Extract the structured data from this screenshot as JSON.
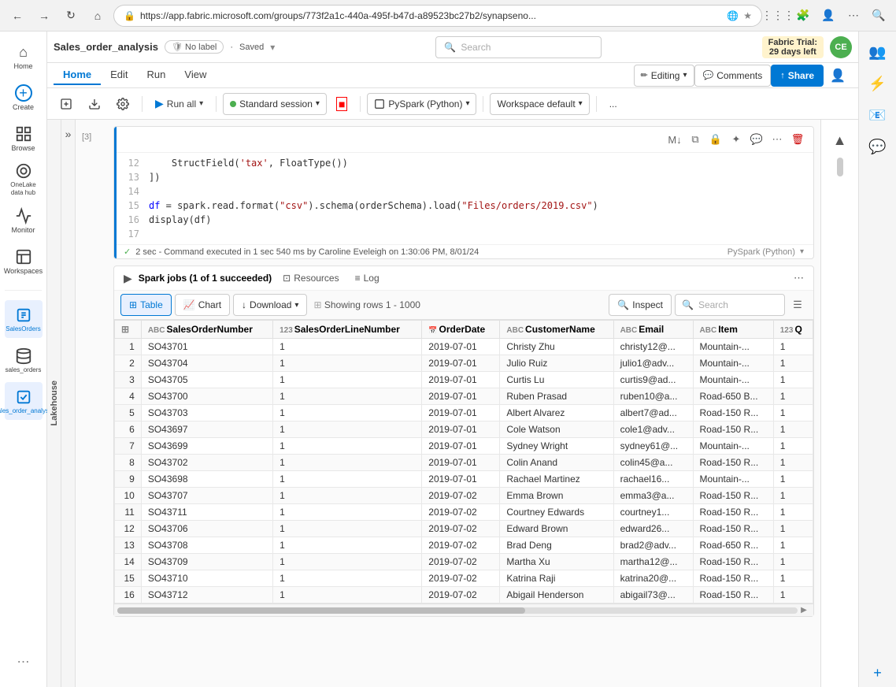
{
  "browser": {
    "url": "https://app.fabric.microsoft.com/groups/773f2a1c-440a-495f-b47d-a89523bc27b2/synapsenо...",
    "search_placeholder": "Search"
  },
  "app": {
    "title": "Sales_order_analysis",
    "no_label": "No label",
    "saved": "Saved",
    "search_placeholder": "Search",
    "fabric_trial_line1": "Fabric Trial:",
    "fabric_trial_line2": "29 days left"
  },
  "header_buttons": {
    "editing": "Editing",
    "comments": "Comments",
    "share": "Share"
  },
  "menu": {
    "tabs": [
      "Home",
      "Edit",
      "Run",
      "View"
    ]
  },
  "toolbar": {
    "run_all": "Run all",
    "session": "Standard session",
    "kernel": "PySpark (Python)",
    "workspace": "Workspace default",
    "more": "..."
  },
  "notebook": {
    "cell_number": "[3]",
    "status_text": "✓  2 sec - Command executed in 1 sec 540 ms by Caroline Eveleigh on 1:30:06 PM, 8/01/24",
    "kernel_right": "PySpark (Python)",
    "code_lines": [
      {
        "num": "12",
        "code": "    StructField('tax', FloatType())"
      },
      {
        "num": "13",
        "code": "])"
      },
      {
        "num": "14",
        "code": ""
      },
      {
        "num": "15",
        "code": "df = spark.read.format(\"csv\").schema(orderSchema).load(\"Files/orders/2019.csv\")"
      },
      {
        "num": "16",
        "code": "display(df)"
      },
      {
        "num": "17",
        "code": ""
      }
    ]
  },
  "spark_jobs": {
    "text": "Spark jobs (1 of 1 succeeded)",
    "tabs": [
      "Resources",
      "Log"
    ],
    "more": "..."
  },
  "table_toolbar": {
    "table_label": "Table",
    "chart_label": "Chart",
    "download_label": "Download",
    "showing": "Showing rows 1 - 1000",
    "inspect": "Inspect",
    "search_placeholder": "Search"
  },
  "table": {
    "columns": [
      {
        "icon": "ABC",
        "label": "SalesOrderNumber"
      },
      {
        "icon": "123",
        "label": "SalesOrderLineNumber"
      },
      {
        "icon": "",
        "label": "OrderDate"
      },
      {
        "icon": "ABC",
        "label": "CustomerName"
      },
      {
        "icon": "ABC",
        "label": "Email"
      },
      {
        "icon": "ABC",
        "label": "Item"
      },
      {
        "icon": "123",
        "label": "Q"
      }
    ],
    "rows": [
      [
        1,
        "SO43701",
        1,
        "2019-07-01",
        "Christy Zhu",
        "christy12@...",
        "Mountain-...",
        1
      ],
      [
        2,
        "SO43704",
        1,
        "2019-07-01",
        "Julio Ruiz",
        "julio1@adv...",
        "Mountain-...",
        1
      ],
      [
        3,
        "SO43705",
        1,
        "2019-07-01",
        "Curtis Lu",
        "curtis9@ad...",
        "Mountain-...",
        1
      ],
      [
        4,
        "SO43700",
        1,
        "2019-07-01",
        "Ruben Prasad",
        "ruben10@a...",
        "Road-650 B...",
        1
      ],
      [
        5,
        "SO43703",
        1,
        "2019-07-01",
        "Albert Alvarez",
        "albert7@ad...",
        "Road-150 R...",
        1
      ],
      [
        6,
        "SO43697",
        1,
        "2019-07-01",
        "Cole Watson",
        "cole1@adv...",
        "Road-150 R...",
        1
      ],
      [
        7,
        "SO43699",
        1,
        "2019-07-01",
        "Sydney Wright",
        "sydney61@...",
        "Mountain-...",
        1
      ],
      [
        8,
        "SO43702",
        1,
        "2019-07-01",
        "Colin Anand",
        "colin45@a...",
        "Road-150 R...",
        1
      ],
      [
        9,
        "SO43698",
        1,
        "2019-07-01",
        "Rachael Martinez",
        "rachael16...",
        "Mountain-...",
        1
      ],
      [
        10,
        "SO43707",
        1,
        "2019-07-02",
        "Emma Brown",
        "emma3@a...",
        "Road-150 R...",
        1
      ],
      [
        11,
        "SO43711",
        1,
        "2019-07-02",
        "Courtney Edwards",
        "courtney1...",
        "Road-150 R...",
        1
      ],
      [
        12,
        "SO43706",
        1,
        "2019-07-02",
        "Edward Brown",
        "edward26...",
        "Road-150 R...",
        1
      ],
      [
        13,
        "SO43708",
        1,
        "2019-07-02",
        "Brad Deng",
        "brad2@adv...",
        "Road-650 R...",
        1
      ],
      [
        14,
        "SO43709",
        1,
        "2019-07-02",
        "Martha Xu",
        "martha12@...",
        "Road-150 R...",
        1
      ],
      [
        15,
        "SO43710",
        1,
        "2019-07-02",
        "Katrina Raji",
        "katrina20@...",
        "Road-150 R...",
        1
      ],
      [
        16,
        "SO43712",
        1,
        "2019-07-02",
        "Abigail Henderson",
        "abigail73@...",
        "Road-150 R...",
        1
      ]
    ]
  },
  "left_sidebar": {
    "items": [
      {
        "icon": "⌂",
        "label": "Home"
      },
      {
        "icon": "+",
        "label": "Create"
      },
      {
        "icon": "⊞",
        "label": "Browse"
      },
      {
        "icon": "◎",
        "label": "OneLake data hub"
      },
      {
        "icon": "◈",
        "label": "Monitor"
      },
      {
        "icon": "⊞",
        "label": "Workspaces"
      },
      {
        "icon": "⊡",
        "label": "SalesOrders"
      },
      {
        "icon": "⊡",
        "label": "sales_orders"
      },
      {
        "icon": "⊡",
        "label": "Sales_order_analysis"
      }
    ]
  }
}
